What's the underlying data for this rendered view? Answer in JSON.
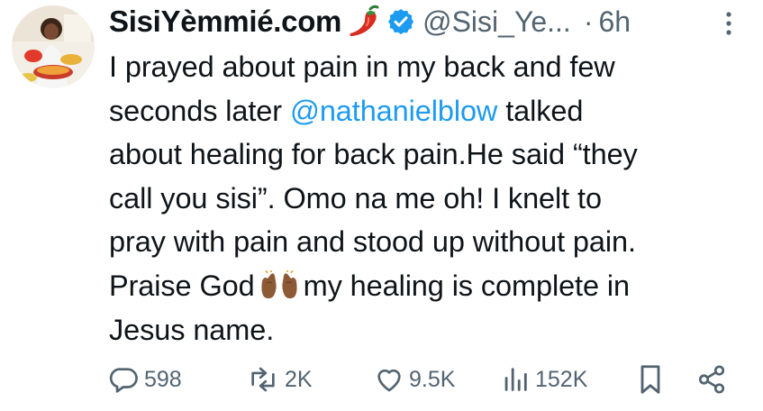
{
  "author": {
    "display_name": "SisiYèmmié.com",
    "handle": "@Sisi_Ye...",
    "separator": "·",
    "time": "6h",
    "verified": true,
    "name_emoji": "hot-pepper-icon"
  },
  "tweet": {
    "lines": [
      {
        "text": "I prayed about pain in my back and few"
      },
      {
        "before": "seconds later ",
        "mention": "@nathanielblow",
        "after": " talked"
      },
      {
        "text": "about healing for back pain.He said “they"
      },
      {
        "text": "call you sisi”.  Omo na me oh! I knelt to"
      },
      {
        "text": "pray with pain and stood up without pain."
      },
      {
        "before": "Praise God",
        "emoji": "raising-hands-icon",
        "after": "my healing is complete in"
      },
      {
        "text": "Jesus name."
      }
    ]
  },
  "actions": {
    "replies": "598",
    "reposts": "2K",
    "likes": "9.5K",
    "views": "152K"
  },
  "colors": {
    "text": "#0f1419",
    "secondary": "#536471",
    "mention": "#1d9bf0",
    "verified_badge": "#1d9bf0"
  }
}
